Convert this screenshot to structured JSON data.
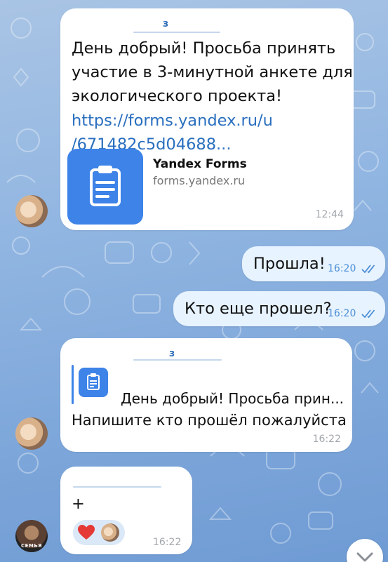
{
  "messages": [
    {
      "id": "m1",
      "direction": "incoming",
      "sender_mark": "з",
      "lines": [
        "День добрый! Просьба принять",
        "участие в 3-минутной анкете для",
        "экологического проекта!"
      ],
      "link_lines": [
        "https://forms.yandex.ru/u",
        "/671482c5d04688..."
      ],
      "preview": {
        "title": "Yandex Forms",
        "domain": "forms.yandex.ru",
        "icon": "clipboard-icon"
      },
      "time": "12:44"
    },
    {
      "id": "m2",
      "direction": "outgoing",
      "text": "Прошла!",
      "time": "16:20",
      "status": "read"
    },
    {
      "id": "m3",
      "direction": "outgoing",
      "text": "Кто еще прошел?",
      "time": "16:20",
      "status": "read"
    },
    {
      "id": "m4",
      "direction": "incoming",
      "sender_mark": "з",
      "reply": {
        "text": "День добрый! Просьба прин...",
        "icon": "clipboard-icon"
      },
      "text": "Напишите кто прошёл пожалуйста",
      "time": "16:22"
    },
    {
      "id": "m5",
      "direction": "incoming",
      "text": "+",
      "reactions": [
        {
          "emoji": "heart",
          "by": "avatar"
        }
      ],
      "time": "16:22"
    }
  ],
  "avatars": {
    "family_label": "СЕМЬЯ"
  },
  "colors": {
    "incoming": "#ffffff",
    "outgoing": "#e7f3ff",
    "link": "#2a6fbf",
    "accent": "#3d83e8"
  },
  "scroll_button": {
    "icon": "chevron-down-icon"
  }
}
